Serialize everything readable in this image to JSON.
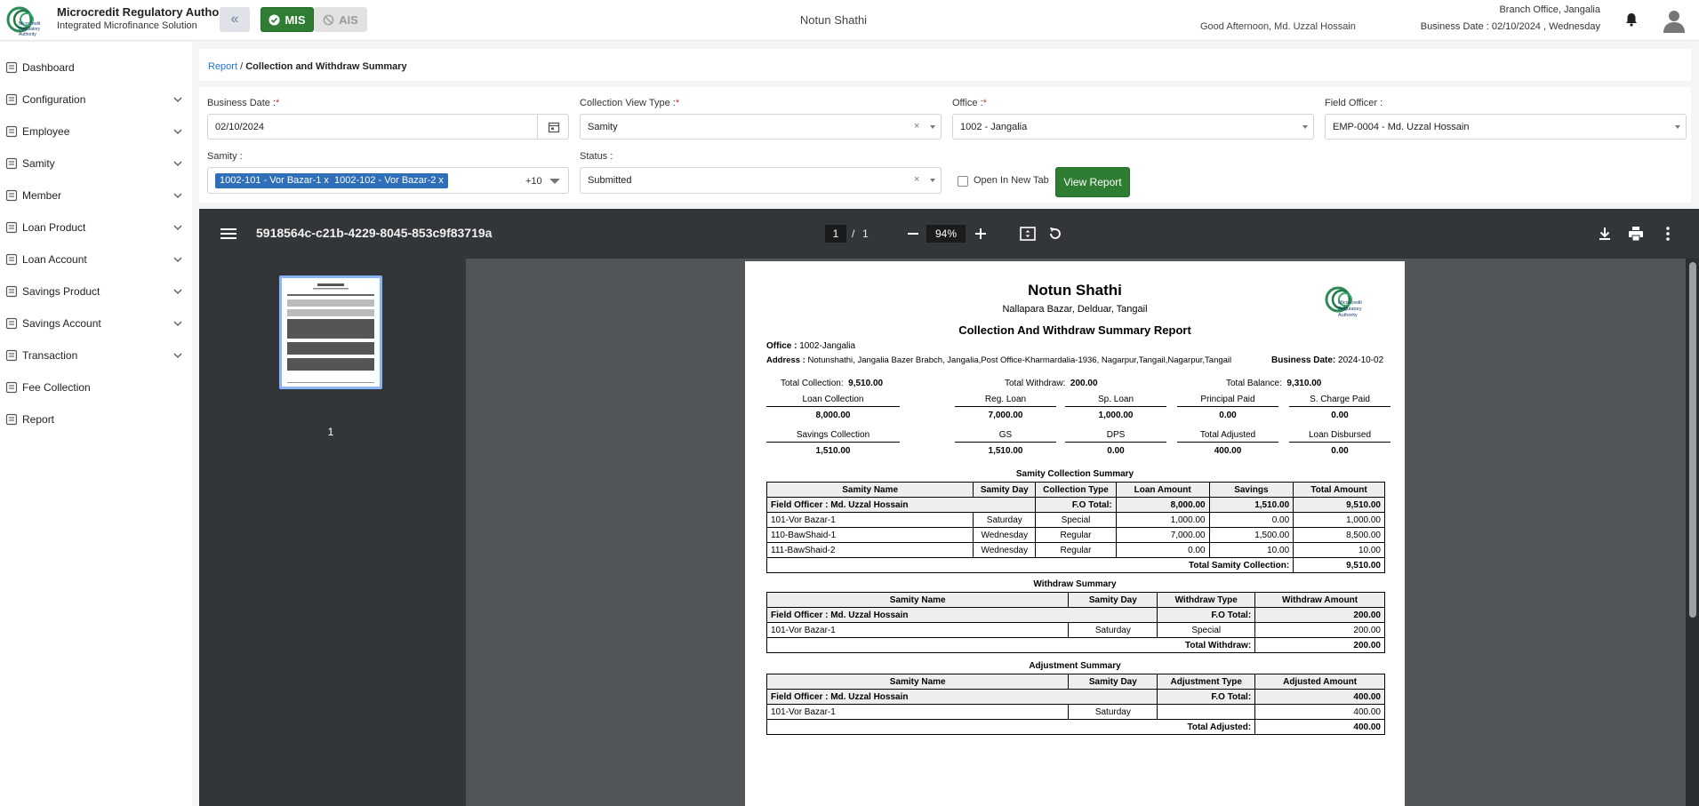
{
  "header": {
    "brand_title": "Microcredit Regulatory Authority",
    "brand_sub": "Integrated Microfinance Solution",
    "logo_text_1": "Microcredit",
    "logo_text_2": "Regulatory",
    "logo_text_3": "Authority",
    "mis_label": "MIS",
    "ais_label": "AIS",
    "center_title": "Notun Shathi",
    "greeting": "Good Afternoon, Md. Uzzal Hossain",
    "branch": "Branch Office, Jangalia",
    "business_date": "Business Date : 02/10/2024 , Wednesday"
  },
  "sidebar": {
    "items": [
      {
        "label": "Dashboard",
        "icon": "dashboard-icon",
        "expandable": false
      },
      {
        "label": "Configuration",
        "icon": "sliders-icon",
        "expandable": true
      },
      {
        "label": "Employee",
        "icon": "employee-icon",
        "expandable": true
      },
      {
        "label": "Samity",
        "icon": "handshake-icon",
        "expandable": true
      },
      {
        "label": "Member",
        "icon": "member-icon",
        "expandable": true
      },
      {
        "label": "Loan Product",
        "icon": "loan-product-icon",
        "expandable": true
      },
      {
        "label": "Loan Account",
        "icon": "loan-account-icon",
        "expandable": true
      },
      {
        "label": "Savings Product",
        "icon": "savings-product-icon",
        "expandable": true
      },
      {
        "label": "Savings Account",
        "icon": "savings-account-icon",
        "expandable": true
      },
      {
        "label": "Transaction",
        "icon": "transaction-icon",
        "expandable": true
      },
      {
        "label": "Fee Collection",
        "icon": "fee-icon",
        "expandable": false
      },
      {
        "label": "Report",
        "icon": "report-icon",
        "expandable": false
      }
    ]
  },
  "breadcrumb": {
    "root": "Report",
    "sep": "/",
    "current": "Collection and Withdraw Summary"
  },
  "filters": {
    "business_date_label": "Business Date :",
    "business_date_value": "02/10/2024",
    "collection_view_label": "Collection View Type :",
    "collection_view_value": "Samity",
    "office_label": "Office :",
    "office_value": "1002 - Jangalia",
    "field_officer_label": "Field Officer :",
    "field_officer_value": "EMP-0004 - Md. Uzzal Hossain",
    "samity_label": "Samity :",
    "samity_chips": [
      "1002-101 - Vor Bazar-1",
      "1002-102 - Vor Bazar-2"
    ],
    "samity_more": "+10",
    "status_label": "Status :",
    "status_value": "Submitted",
    "open_new_tab_label": "Open In New Tab",
    "view_report_label": "View Report",
    "required_mark": "*",
    "clear_mark": "×",
    "chip_remove": "x"
  },
  "viewer": {
    "file_name": "5918564c-c21b-4229-8045-853c9f83719a",
    "page_current": "1",
    "page_sep": "/",
    "page_total": "1",
    "zoom": "94%",
    "thumb_number": "1"
  },
  "report": {
    "org_name": "Notun Shathi",
    "org_address": "Nallapara Bazar, Delduar, Tangail",
    "report_title": "Collection And Withdraw Summary Report",
    "office_label": "Office :",
    "office_value": "1002-Jangalia",
    "address_label": "Address :",
    "address_value": "Notunshathi, Jangalia Bazer Brabch, Jangalia,Post Office-Kharmardalia-1936, Nagarpur,Tangail,Nagarpur,Tangail",
    "bizdate_label": "Business Date:",
    "bizdate_value": "2024-10-02",
    "total_collection_label": "Total Collection:",
    "total_collection_value": "9,510.00",
    "total_withdraw_label": "Total Withdraw:",
    "total_withdraw_value": "200.00",
    "total_balance_label": "Total Balance:",
    "total_balance_value": "9,310.00",
    "metrics_row1": [
      {
        "t": "Loan Collection",
        "v": "8,000.00"
      },
      {
        "t": "Reg. Loan",
        "v": "7,000.00"
      },
      {
        "t": "Sp. Loan",
        "v": "1,000.00"
      },
      {
        "t": "Principal Paid",
        "v": "0.00"
      },
      {
        "t": "S. Charge Paid",
        "v": "0.00"
      }
    ],
    "metrics_row2": [
      {
        "t": "Savings Collection",
        "v": "1,510.00"
      },
      {
        "t": "GS",
        "v": "1,510.00"
      },
      {
        "t": "DPS",
        "v": "0.00"
      },
      {
        "t": "Total Adjusted",
        "v": "400.00"
      },
      {
        "t": "Loan Disbursed",
        "v": "0.00"
      }
    ],
    "samity_section_title": "Samity Collection Summary",
    "samity_headers": [
      "Samity Name",
      "Samity Day",
      "Collection Type",
      "Loan Amount",
      "Savings",
      "Total Amount"
    ],
    "samity_fo_label": "Field Officer : Md. Uzzal Hossain",
    "samity_fo_total_label": "F.O Total:",
    "samity_fo_totals": [
      "8,000.00",
      "1,510.00",
      "9,510.00"
    ],
    "samity_rows": [
      [
        "101-Vor Bazar-1",
        "Saturday",
        "Special",
        "1,000.00",
        "0.00",
        "1,000.00"
      ],
      [
        "110-BawShaid-1",
        "Wednesday",
        "Regular",
        "7,000.00",
        "1,500.00",
        "8,500.00"
      ],
      [
        "111-BawShaid-2",
        "Wednesday",
        "Regular",
        "0.00",
        "10.00",
        "10.00"
      ]
    ],
    "samity_grand_label": "Total Samity Collection:",
    "samity_grand_value": "9,510.00",
    "withdraw_section_title": "Withdraw Summary",
    "withdraw_headers": [
      "Samity Name",
      "Samity Day",
      "Withdraw Type",
      "Withdraw Amount"
    ],
    "withdraw_fo_label": "Field Officer : Md. Uzzal Hossain",
    "withdraw_fo_total_label": "F.O Total:",
    "withdraw_fo_total": "200.00",
    "withdraw_rows": [
      [
        "101-Vor Bazar-1",
        "Saturday",
        "Special",
        "200.00"
      ]
    ],
    "withdraw_grand_label": "Total Withdraw:",
    "withdraw_grand_value": "200.00",
    "adjust_section_title": "Adjustment Summary",
    "adjust_headers": [
      "Samity Name",
      "Samity Day",
      "Adjustment Type",
      "Adjusted Amount"
    ],
    "adjust_fo_label": "Field Officer : Md. Uzzal Hossain",
    "adjust_fo_total_label": "F.O Total:",
    "adjust_fo_total": "400.00",
    "adjust_rows": [
      [
        "101-Vor Bazar-1",
        "Saturday",
        "",
        "400.00"
      ]
    ],
    "adjust_grand_label": "Total Adjusted:",
    "adjust_grand_value": "400.00"
  },
  "colors": {
    "primary_green": "#2e7d32",
    "chip_blue": "#2f6fb7",
    "link_blue": "#1976d2",
    "viewer_dark": "#323639"
  }
}
